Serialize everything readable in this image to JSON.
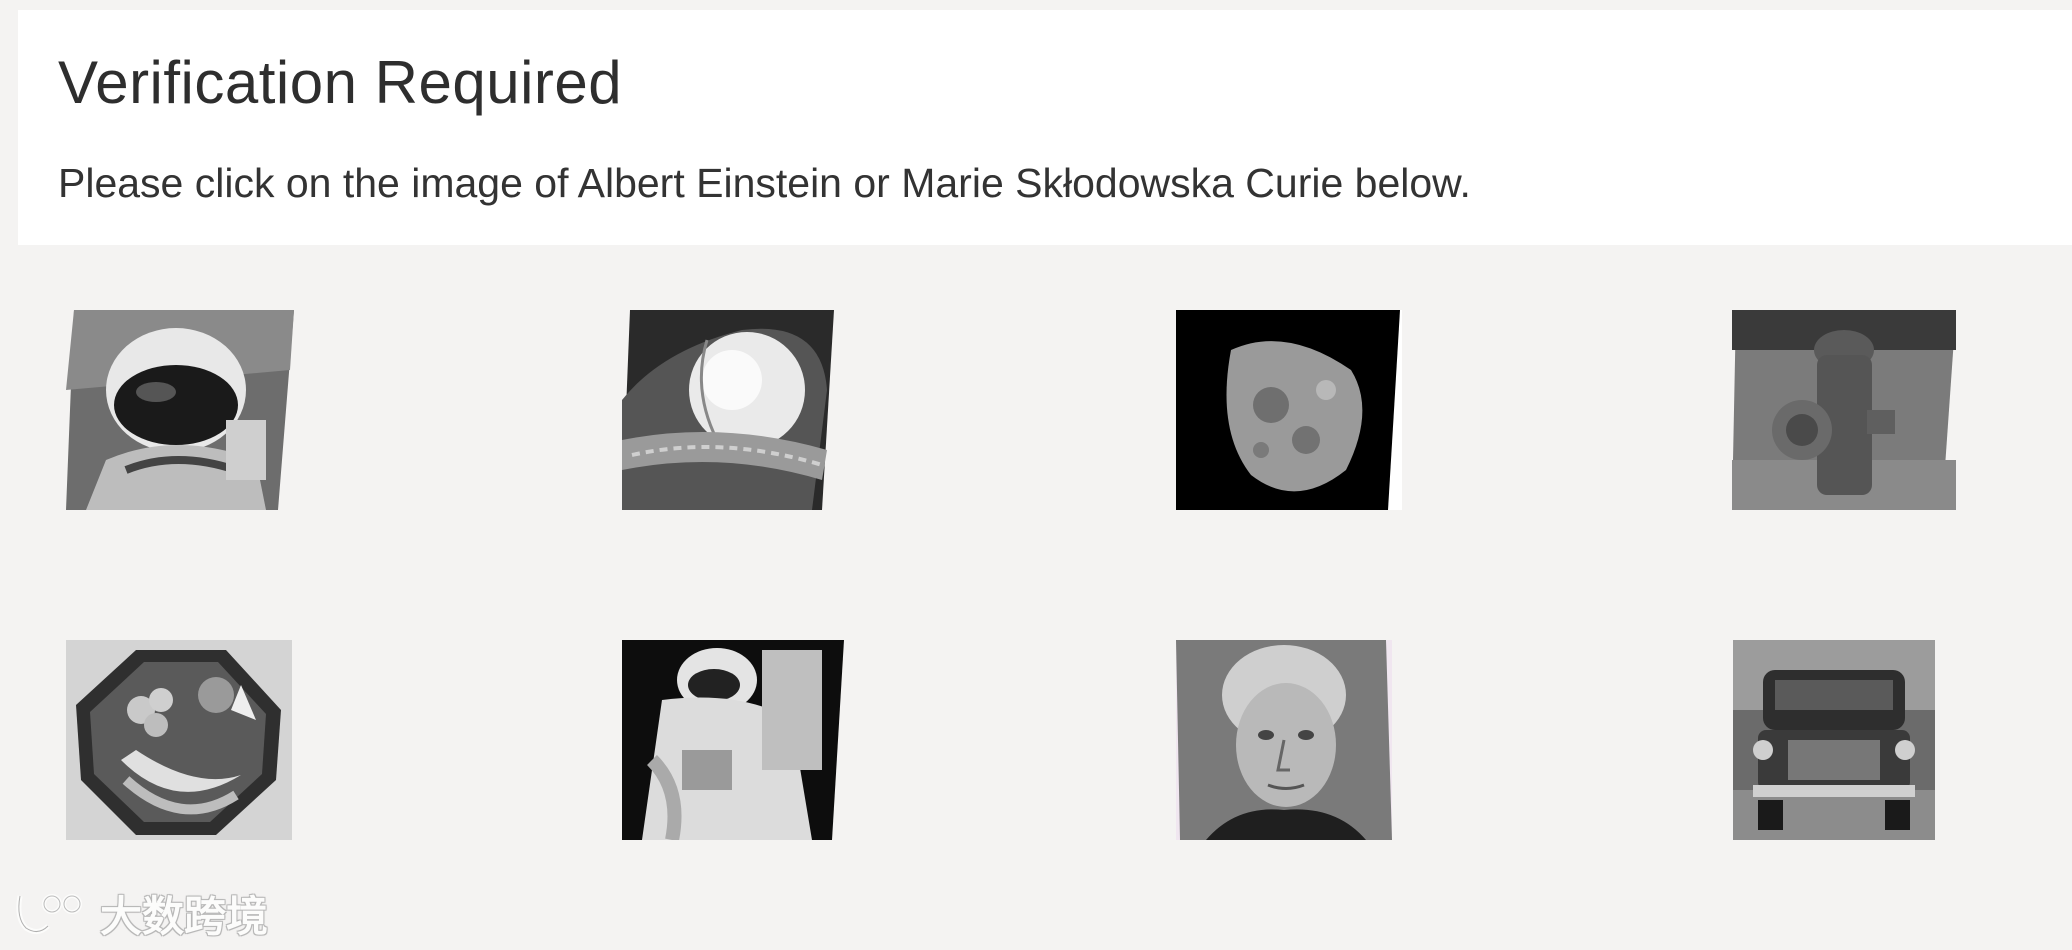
{
  "challenge": {
    "title": "Verification Required",
    "instructions": "Please click on the image of Albert Einstein or Marie Skłodowska Curie below."
  },
  "images": [
    {
      "name": "astronaut-helmet",
      "depicts": "astronaut in helmet"
    },
    {
      "name": "baseball-glove",
      "depicts": "baseball in glove"
    },
    {
      "name": "moon",
      "depicts": "half moon"
    },
    {
      "name": "fire-hydrant",
      "depicts": "fire hydrant"
    },
    {
      "name": "fruit-plate",
      "depicts": "fruit on octagonal sign"
    },
    {
      "name": "astronaut-spacewalk",
      "depicts": "astronaut spacewalk"
    },
    {
      "name": "marie-curie",
      "depicts": "portrait of Marie Skłodowska Curie"
    },
    {
      "name": "truck",
      "depicts": "vintage truck"
    }
  ],
  "watermark": {
    "text": "大数跨境"
  },
  "colors": {
    "background": "#f4f3f2",
    "panel": "#ffffff",
    "text": "#333333"
  }
}
